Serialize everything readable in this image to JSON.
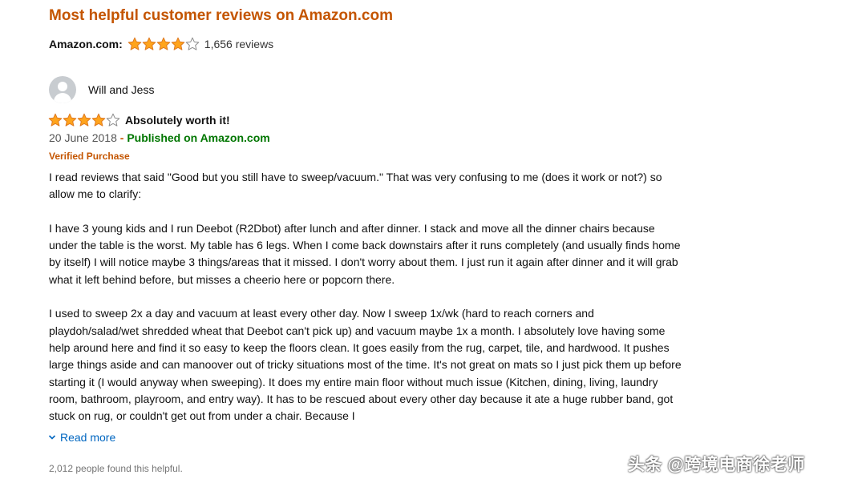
{
  "section": {
    "heading": "Most helpful customer reviews on Amazon.com"
  },
  "summary": {
    "label": "Amazon.com:",
    "rating": 4,
    "rating_max": 5,
    "count_text": "1,656 reviews"
  },
  "review": {
    "reviewer_name": "Will and Jess",
    "rating": 4,
    "rating_max": 5,
    "title": "Absolutely worth it!",
    "date": "20 June 2018",
    "separator": " - ",
    "published": "Published on Amazon.com",
    "verified": "Verified Purchase",
    "paragraphs": [
      "I read reviews that said \"Good but you still have to sweep/vacuum.\" That was very confusing to me (does it work or not?) so allow me to clarify:",
      "I have 3 young kids and I run Deebot (R2Dbot) after lunch and after dinner. I stack and move all the dinner chairs because under the table is the worst. My table has 6 legs. When I come back downstairs after it runs completely (and usually finds home by itself) I will notice maybe 3 things/areas that it missed. I don't worry about them. I just run it again after dinner and it will grab what it left behind before, but misses a cheerio here or popcorn there.",
      "I used to sweep 2x a day and vacuum at least every other day. Now I sweep 1x/wk (hard to reach corners and playdoh/salad/wet shredded wheat that Deebot can't pick up) and vacuum maybe 1x a month. I absolutely love having some help around here and find it so easy to keep the floors clean. It goes easily from the rug, carpet, tile, and hardwood. It pushes large things aside and can manoover out of tricky situations most of the time. It's not great on mats so I just pick them up before starting it (I would anyway when sweeping). It does my entire main floor without much issue (Kitchen, dining, living, laundry room, bathroom, playroom, and entry way). It has to be rescued about every other day because it ate a huge rubber band, got stuck on rug, or couldn't get out from under a chair. Because I"
    ],
    "read_more": "Read more",
    "helpful_text": "2,012 people found this helpful."
  },
  "watermark": "头条 @跨境电商徐老师",
  "colors": {
    "heading": "#c45500",
    "star_fill": "#ffa41c",
    "star_stroke": "#de7921",
    "published": "#007600",
    "link": "#0066c0"
  }
}
